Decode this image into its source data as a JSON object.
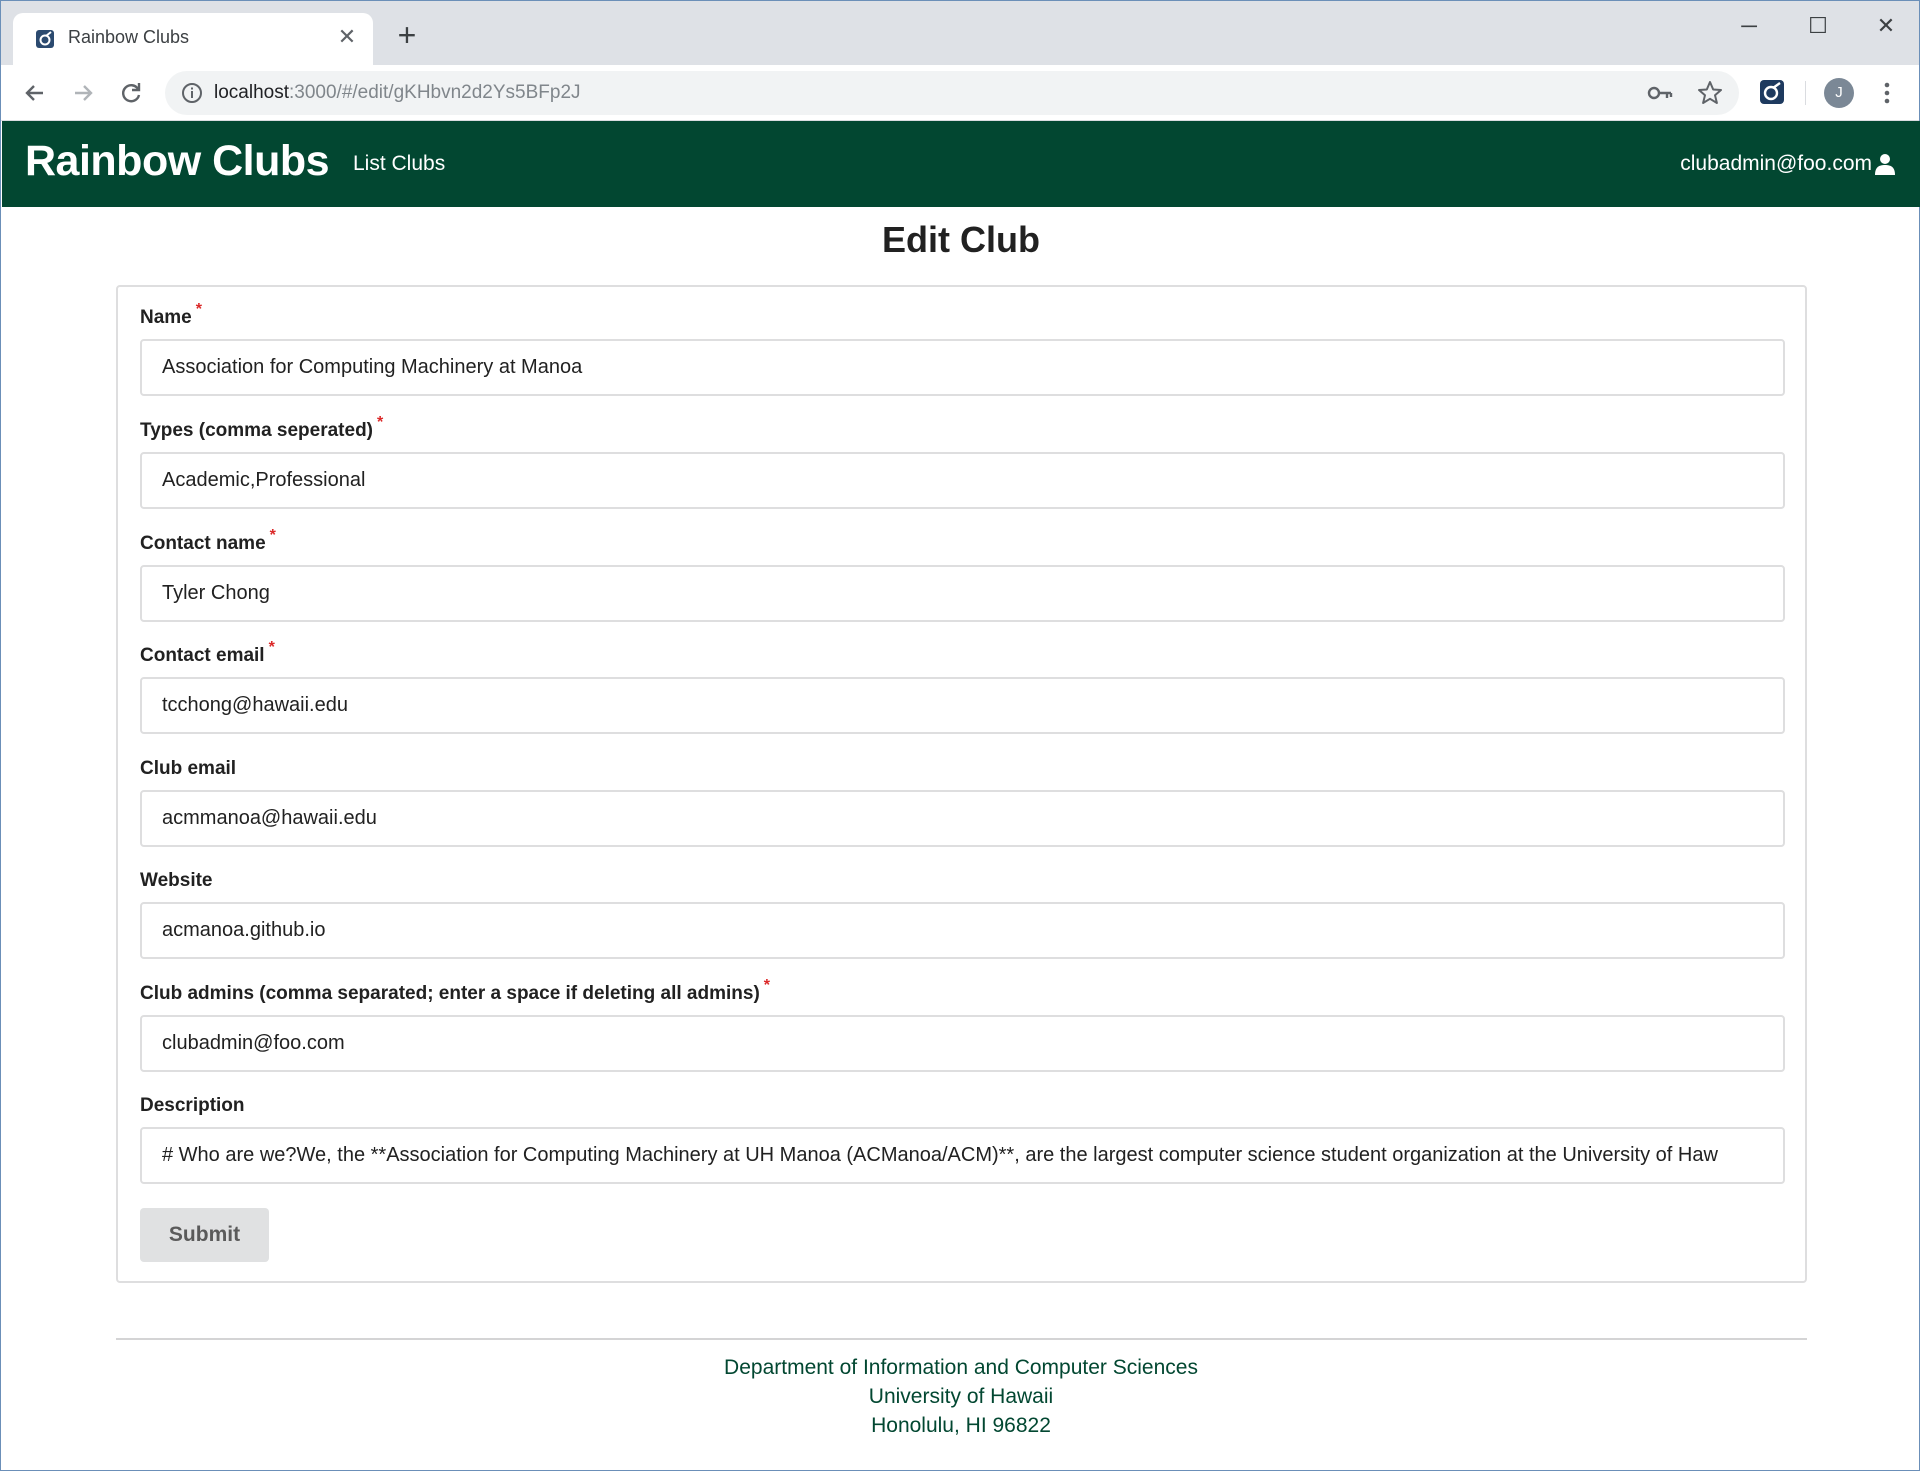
{
  "browser": {
    "tab_title": "Rainbow Clubs",
    "new_tab_icon": "plus-icon",
    "url_host": "localhost",
    "url_rest": ":3000/#/edit/gKHbvn2d2Ys5BFp2J",
    "profile_initial": "J"
  },
  "navbar": {
    "brand": "Rainbow Clubs",
    "list_clubs": "List Clubs",
    "user_email": "clubadmin@foo.com",
    "bg_color": "#024731"
  },
  "page": {
    "title": "Edit Club"
  },
  "form": {
    "fields": [
      {
        "label": "Name",
        "required": true,
        "value": "Association for Computing Machinery at Manoa"
      },
      {
        "label": "Types (comma seperated)",
        "required": true,
        "value": "Academic,Professional"
      },
      {
        "label": "Contact name",
        "required": true,
        "value": "Tyler Chong"
      },
      {
        "label": "Contact email",
        "required": true,
        "value": "tcchong@hawaii.edu"
      },
      {
        "label": "Club email",
        "required": false,
        "value": "acmmanoa@hawaii.edu"
      },
      {
        "label": "Website",
        "required": false,
        "value": "acmanoa.github.io"
      },
      {
        "label": "Club admins (comma separated; enter a space if deleting all admins)",
        "required": true,
        "value": "clubadmin@foo.com"
      },
      {
        "label": "Description",
        "required": false,
        "value": "# Who are we?We, the **Association for Computing Machinery at UH Manoa (ACManoa/ACM)**, are the largest computer science student organization at the University of Haw"
      }
    ],
    "required_marker": "*",
    "submit_label": "Submit"
  },
  "footer": {
    "line1": "Department of Information and Computer Sciences",
    "line2": "University of Hawaii",
    "line3": "Honolulu, HI 96822"
  }
}
